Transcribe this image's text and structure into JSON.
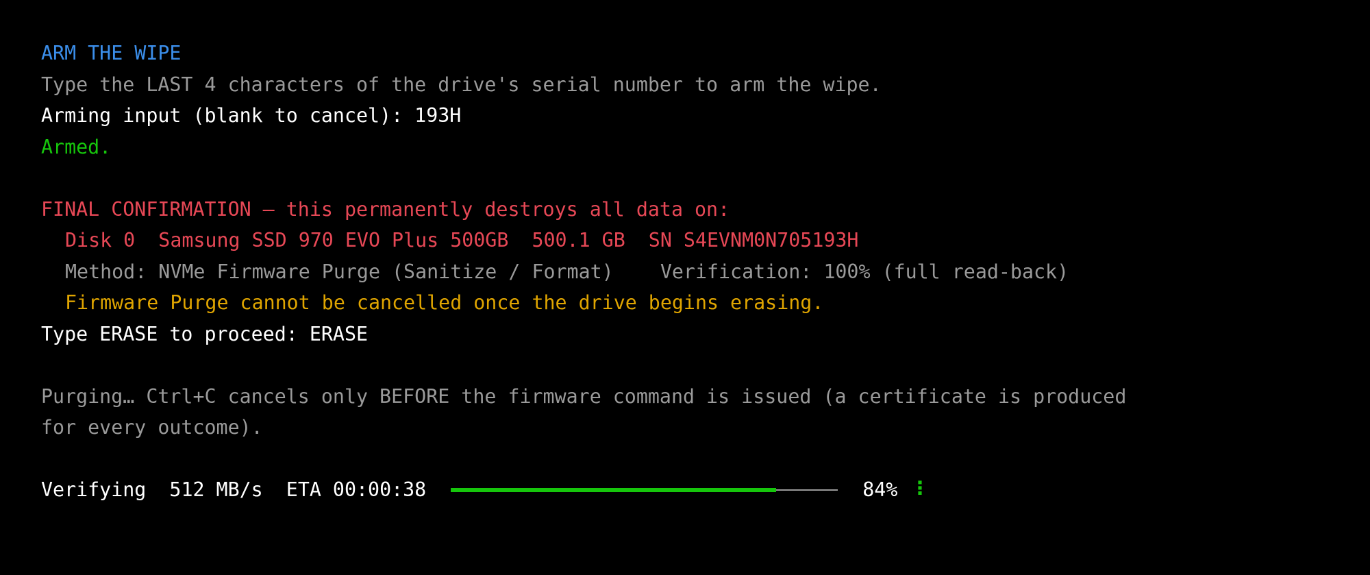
{
  "arm": {
    "heading": "ARM THE WIPE",
    "instruction": "Type the LAST 4 characters of the drive's serial number to arm the wipe.",
    "prompt": "Arming input (blank to cancel): ",
    "input_value": "193H",
    "status": "Armed."
  },
  "confirm": {
    "heading": "FINAL CONFIRMATION — this permanently destroys all data on:",
    "disk_line": "Disk 0  Samsung SSD 970 EVO Plus 500GB  500.1 GB  SN S4EVNM0N705193H",
    "method_line": "Method: NVMe Firmware Purge (Sanitize / Format)    Verification: 100% (full read-back)",
    "warning": "Firmware Purge cannot be cancelled once the drive begins erasing.",
    "prompt": "Type ERASE to proceed: ",
    "input_value": "ERASE"
  },
  "purge": {
    "note_line1": "Purging… Ctrl+C cancels only BEFORE the firmware command is issued (a certificate is produced",
    "note_line2": "for every outcome)."
  },
  "progress": {
    "phase": "Verifying",
    "speed": "512 MB/s",
    "eta": "ETA 00:00:38",
    "percent_label": "84%",
    "fraction": 0.84,
    "spinner_glyph": "⠸"
  },
  "colors": {
    "background": "#000000",
    "heading_blue": "#3b8eea",
    "muted_gray": "#9a9a9a",
    "ok_green": "#16c60c",
    "danger_red": "#e74856",
    "warning_yellow": "#e0a500"
  }
}
